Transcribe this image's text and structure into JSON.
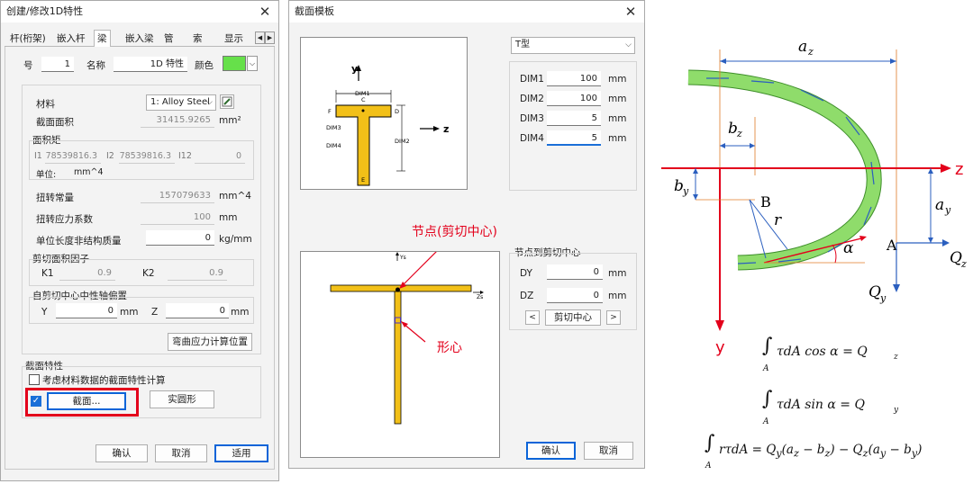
{
  "dialog1": {
    "title": "创建/修改1D特性",
    "close": "✕",
    "tabs": [
      "杆(桁架)",
      "嵌入杆",
      "梁",
      "嵌入梁",
      "管",
      "索",
      "显示"
    ],
    "number_label": "号",
    "number_value": "1",
    "name_label": "名称",
    "name_value": "1D 特性",
    "color_label": "颜色",
    "color_value": "#66e04a",
    "material_label": "材料",
    "material_value": "1: Alloy Steel",
    "area_label": "截面面积",
    "area_value": "31415.9265",
    "area_unit": "mm²",
    "moi_group": "面积矩",
    "i1_label": "I1",
    "i1_value": "78539816.3",
    "i2_label": "I2",
    "i2_value": "78539816.3",
    "i12_label": "I12",
    "i12_value": "0",
    "unit_label": "单位:",
    "unit_value": "mm^4",
    "torsion_label": "扭转常量",
    "torsion_value": "157079633",
    "torsion_unit": "mm^4",
    "torsion_stress_label": "扭转应力系数",
    "torsion_stress_value": "100",
    "torsion_stress_unit": "mm",
    "mass_label": "单位长度非结构质量",
    "mass_value": "0",
    "mass_unit": "kg/mm",
    "shear_group": "剪切面积因子",
    "k1_label": "K1",
    "k1_value": "0.9",
    "k2_label": "K2",
    "k2_value": "0.9",
    "offset_group": "自剪切中心中性轴偏置",
    "y_label": "Y",
    "y_value": "0",
    "y_unit": "mm",
    "z_label": "Z",
    "z_value": "0",
    "z_unit": "mm",
    "bending_button": "弯曲应力计算位置",
    "section_group": "截面特性",
    "consider_material_label": "考虑材料数据的截面特性计算",
    "section_button": "截面...",
    "solid_button": "实圆形",
    "ok": "确认",
    "cancel": "取消",
    "apply": "适用"
  },
  "dialog2": {
    "title": "截面模板",
    "close": "✕",
    "type_value": "T型",
    "dims": [
      {
        "label": "DIM1",
        "value": "100",
        "unit": "mm"
      },
      {
        "label": "DIM2",
        "value": "100",
        "unit": "mm"
      },
      {
        "label": "DIM3",
        "value": "5",
        "unit": "mm"
      },
      {
        "label": "DIM4",
        "value": "5",
        "unit": "mm"
      }
    ],
    "diagram_labels": {
      "y": "y",
      "z": "z",
      "dim1": "DIM1",
      "dim2": "DIM2",
      "dim3": "DIM3",
      "dim4": "DIM4",
      "c": "C",
      "d": "D",
      "e": "E",
      "f": "F"
    },
    "preview_labels": {
      "ys": "Ys",
      "zs": "Zs"
    },
    "annotation_node": "节点(剪切中心)",
    "annotation_centroid": "形心",
    "node_group": "节点到剪切中心",
    "dy_label": "DY",
    "dy_value": "0",
    "dz_label": "DZ",
    "dz_value": "0",
    "unit_mm": "mm",
    "prev": "<",
    "shear_center_button": "剪切中心",
    "next": ">",
    "ok": "确认",
    "cancel": "取消"
  },
  "formula": {
    "az": "a",
    "az_sub": "z",
    "bz": "b",
    "bz_sub": "z",
    "by": "b",
    "by_sub": "y",
    "ay": "a",
    "ay_sub": "y",
    "axis_z": "z",
    "axis_y": "y",
    "point_b": "B",
    "point_a": "A",
    "r": "r",
    "alpha": "α",
    "qz": "Q",
    "qz_sub": "z",
    "qy": "Q",
    "qy_sub": "y",
    "eq1": "τdA cos α = Q",
    "eq1_sub": "z",
    "eq2": "τdA sin α = Q",
    "eq2_sub": "y",
    "eq3_a": "rτdA = Q",
    "eq3_b": "(a",
    "eq3_c": " − b",
    "eq3_d": ") − Q",
    "eq3_e": "(a",
    "eq3_f": " − b",
    "eq3_g": ")",
    "integral_sub": "A",
    "red": "#e3001b",
    "green": "#7ed957",
    "blue": "#2b5fbf"
  }
}
